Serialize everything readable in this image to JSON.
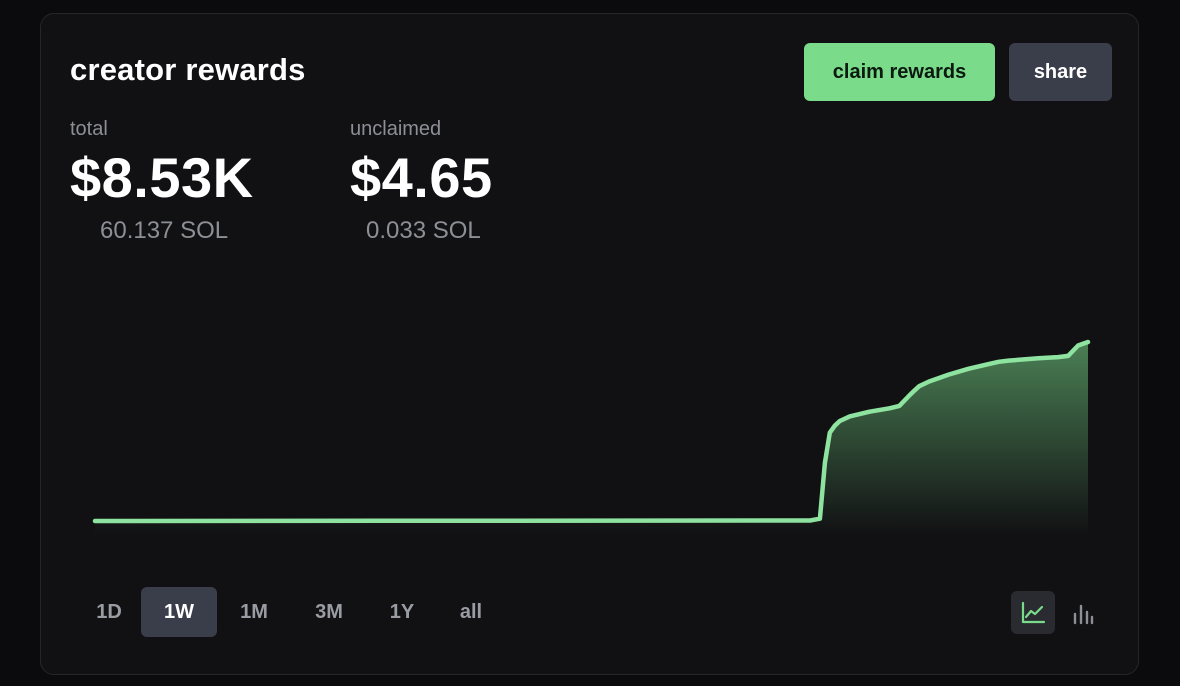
{
  "card": {
    "title": "creator rewards",
    "buttons": {
      "claim": "claim rewards",
      "share": "share"
    }
  },
  "stats": {
    "total": {
      "label": "total",
      "value": "$8.53K",
      "sol": "60.137 SOL"
    },
    "unclaimed": {
      "label": "unclaimed",
      "value": "$4.65",
      "sol": "0.033 SOL"
    }
  },
  "time_ranges": [
    {
      "label": "1D",
      "active": false
    },
    {
      "label": "1W",
      "active": true
    },
    {
      "label": "1M",
      "active": false
    },
    {
      "label": "3M",
      "active": false
    },
    {
      "label": "1Y",
      "active": false
    },
    {
      "label": "all",
      "active": false
    }
  ],
  "view_toggles": {
    "line_icon": "line-chart-icon",
    "bar_icon": "bar-chart-icon",
    "active": "line"
  },
  "colors": {
    "accent": "#7adb8a",
    "line": "#8fe3a0",
    "button_secondary": "#3a3e4a",
    "background": "#111113"
  },
  "chart_data": {
    "type": "area",
    "title": "",
    "xlabel": "",
    "ylabel": "",
    "grid": false,
    "ylim": [
      0,
      8.53
    ],
    "x": [
      0,
      0.72,
      0.73,
      0.735,
      0.74,
      0.745,
      0.75,
      0.76,
      0.78,
      0.8,
      0.81,
      0.82,
      0.825,
      0.83,
      0.84,
      0.86,
      0.88,
      0.9,
      0.91,
      0.92,
      0.95,
      0.97,
      0.98,
      0.99,
      1.0
    ],
    "series": [
      {
        "values": [
          0,
          0.02,
          0.1,
          2.5,
          3.8,
          4.1,
          4.3,
          4.5,
          4.7,
          4.85,
          4.95,
          5.4,
          5.6,
          5.8,
          6.0,
          6.3,
          6.55,
          6.75,
          6.85,
          6.9,
          7.0,
          7.05,
          7.1,
          7.55,
          7.7
        ]
      }
    ]
  }
}
